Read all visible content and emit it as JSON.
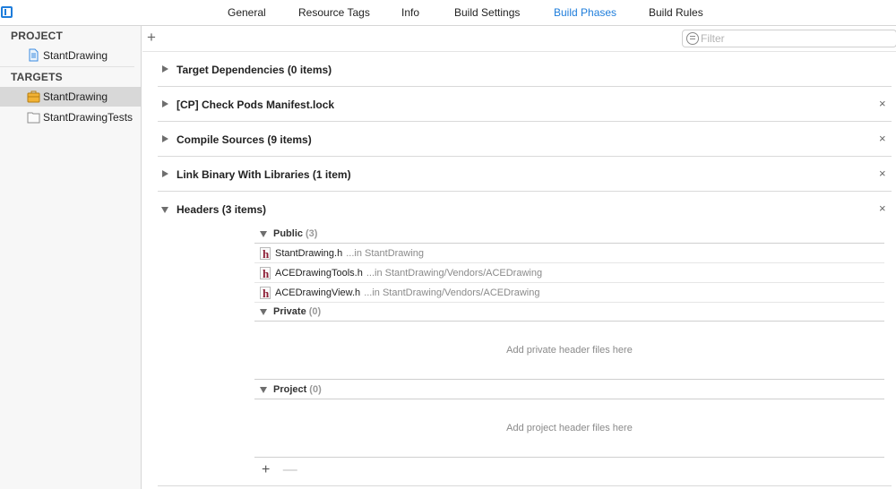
{
  "tabs": {
    "general": "General",
    "resource_tags": "Resource Tags",
    "info": "Info",
    "build_settings": "Build Settings",
    "build_phases": "Build Phases",
    "build_rules": "Build Rules",
    "active": "Build Phases"
  },
  "sidebar": {
    "project_header": "PROJECT",
    "project_name": "StantDrawing",
    "targets_header": "TARGETS",
    "targets": [
      {
        "label": "StantDrawing",
        "icon": "app-target-icon",
        "selected": true
      },
      {
        "label": "StantDrawingTests",
        "icon": "test-bundle-icon",
        "selected": false
      }
    ]
  },
  "toolbar": {
    "add_label": "+",
    "filter_placeholder": "Filter"
  },
  "phases": [
    {
      "title": "Target Dependencies (0 items)",
      "expanded": false,
      "removable": false
    },
    {
      "title": "[CP] Check Pods Manifest.lock",
      "expanded": false,
      "removable": true
    },
    {
      "title": "Compile Sources (9 items)",
      "expanded": false,
      "removable": true
    },
    {
      "title": "Link Binary With Libraries (1 item)",
      "expanded": false,
      "removable": true
    },
    {
      "title": "Headers (3 items)",
      "expanded": true,
      "removable": true
    }
  ],
  "close_glyph": "×",
  "headers": {
    "public": {
      "name": "Public",
      "count": "(3)"
    },
    "files": [
      {
        "name": "StantDrawing.h",
        "path": "...in StantDrawing"
      },
      {
        "name": "ACEDrawingTools.h",
        "path": "...in StantDrawing/Vendors/ACEDrawing"
      },
      {
        "name": "ACEDrawingView.h",
        "path": "...in StantDrawing/Vendors/ACEDrawing"
      }
    ],
    "private": {
      "name": "Private",
      "count": "(0)",
      "empty_message": "Add private header files here"
    },
    "project": {
      "name": "Project",
      "count": "(0)",
      "empty_message": "Add project header files here"
    },
    "add_label": "+",
    "remove_label": "—",
    "file_icon_letter": "h"
  },
  "colors": {
    "accent": "#1e7ddb",
    "sidebar_bg": "#f7f7f7",
    "selected_bg": "#d8d8d8",
    "header_icon": "#8c1d35"
  }
}
